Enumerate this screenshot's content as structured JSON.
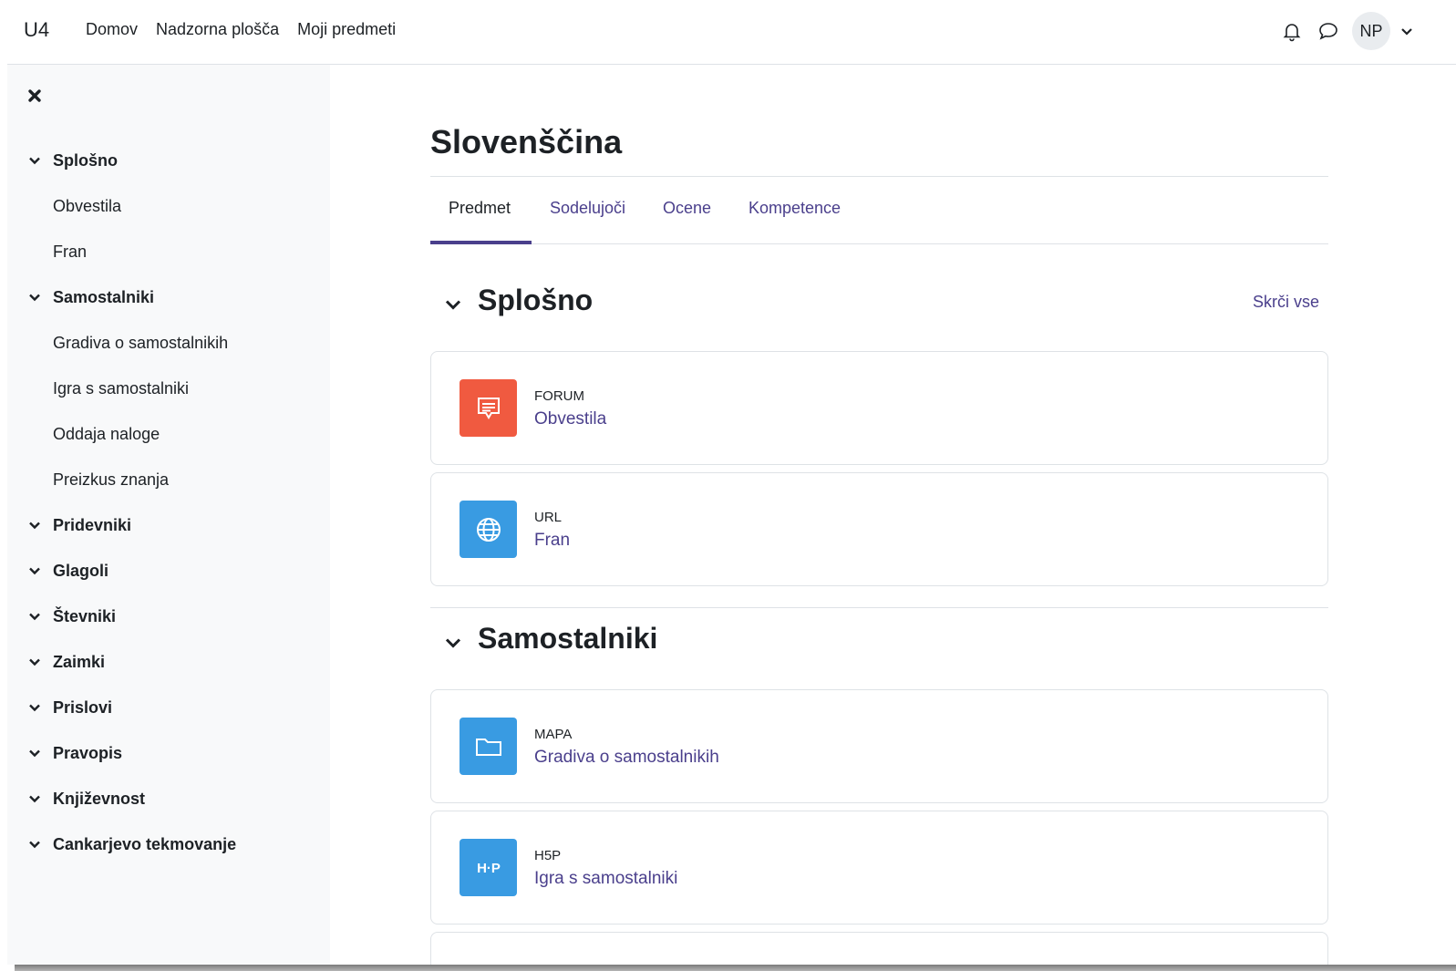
{
  "topbar": {
    "brand": "U4",
    "links": [
      "Domov",
      "Nadzorna plošča",
      "Moji predmeti"
    ],
    "avatar_initials": "NP"
  },
  "drawer": {
    "items": [
      {
        "label": "Splošno",
        "kind": "section"
      },
      {
        "label": "Obvestila",
        "kind": "activity"
      },
      {
        "label": "Fran",
        "kind": "activity"
      },
      {
        "label": "Samostalniki",
        "kind": "section"
      },
      {
        "label": "Gradiva o samostalnikih",
        "kind": "activity"
      },
      {
        "label": "Igra s samostalniki",
        "kind": "activity"
      },
      {
        "label": "Oddaja naloge",
        "kind": "activity"
      },
      {
        "label": "Preizkus znanja",
        "kind": "activity"
      },
      {
        "label": "Pridevniki",
        "kind": "section"
      },
      {
        "label": "Glagoli",
        "kind": "section"
      },
      {
        "label": "Števniki",
        "kind": "section"
      },
      {
        "label": "Zaimki",
        "kind": "section"
      },
      {
        "label": "Prislovi",
        "kind": "section"
      },
      {
        "label": "Pravopis",
        "kind": "section"
      },
      {
        "label": "Književnost",
        "kind": "section"
      },
      {
        "label": "Cankarjevo tekmovanje",
        "kind": "section"
      }
    ]
  },
  "course": {
    "title": "Slovenščina",
    "tabs": [
      "Predmet",
      "Sodelujoči",
      "Ocene",
      "Kompetence"
    ],
    "active_tab": "Predmet",
    "collapse_all": "Skrči vse",
    "sections": [
      {
        "name": "Splošno",
        "activities": [
          {
            "type": "FORUM",
            "name": "Obvestila",
            "icon": "forum-icon",
            "color": "#f05a40"
          },
          {
            "type": "URL",
            "name": "Fran",
            "icon": "globe-icon",
            "color": "#399be2"
          }
        ]
      },
      {
        "name": "Samostalniki",
        "activities": [
          {
            "type": "MAPA",
            "name": "Gradiva o samostalnikih",
            "icon": "folder-icon",
            "color": "#399be2"
          },
          {
            "type": "H5P",
            "name": "Igra s samostalniki",
            "icon": "h5p-icon",
            "color": "#399be2"
          }
        ]
      }
    ]
  },
  "colors": {
    "accent": "#4a3f8c",
    "forum": "#f05a40",
    "resource": "#399be2"
  }
}
